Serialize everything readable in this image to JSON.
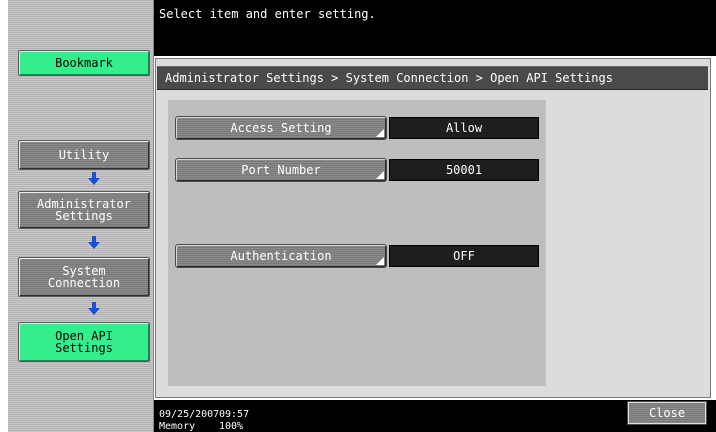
{
  "header": {
    "message": "Select item and enter setting."
  },
  "left_nav": {
    "bookmark_label": "Bookmark",
    "path": [
      {
        "label": "Utility"
      },
      {
        "label": "Administrator\nSettings"
      },
      {
        "label": "System\nConnection"
      },
      {
        "label": "Open API\nSettings",
        "current": true
      }
    ]
  },
  "breadcrumb": "Administrator Settings > System Connection > Open API Settings",
  "settings": [
    {
      "label": "Access Setting",
      "value": "Allow"
    },
    {
      "label": "Port Number",
      "value": "50001"
    },
    {
      "label": "Authentication",
      "value": "OFF"
    }
  ],
  "status": {
    "date": "09/25/2007",
    "time": "09:57",
    "memory_label": "Memory",
    "memory_value": "100%"
  },
  "footer": {
    "close_label": "Close"
  },
  "colors": {
    "accent_green": "#33ee8c",
    "bar_black": "#000000",
    "value_field": "#1e1e1e"
  },
  "icons": {
    "path_arrow": "arrow-down-icon"
  }
}
